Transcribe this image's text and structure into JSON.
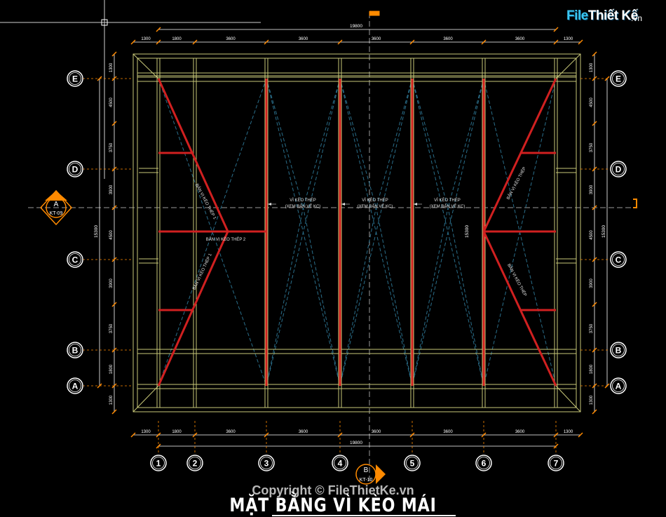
{
  "drawing": {
    "title": "MẶT BẰNG VÌ KÈO MÁI",
    "copyright": "Copyright © FileThietKe.vn",
    "logo_main": "File",
    "logo_main2": "Thiết Kế",
    "logo_suffix": ".vn"
  },
  "dimensions": {
    "total_width": "19800",
    "total_height": "15300",
    "top_segments": [
      "1300",
      "1800",
      "3600",
      "3600",
      "3600",
      "3600",
      "3600",
      "1300"
    ],
    "left_segments": [
      "1300",
      "4500",
      "3750",
      "3900",
      "4500",
      "3900",
      "3750",
      "1800",
      "1300"
    ],
    "inner_height": "15300"
  },
  "grid_axes": {
    "columns": [
      "1",
      "2",
      "3",
      "4",
      "5",
      "6",
      "7"
    ],
    "rows": [
      "E",
      "D",
      "C",
      "B",
      "A"
    ]
  },
  "section_marks": {
    "A": {
      "label": "A",
      "ref": "KT-09"
    },
    "B": {
      "label": "B",
      "ref": "KT-10"
    }
  },
  "annotations": {
    "truss_center": "VÌ KÈO THÉP",
    "truss_center_ref": "(XEM BẢN VẼ KC)",
    "truss_left_1": "BẢN VỊ KÈO THÉP 1",
    "truss_left_2": "BẢN VỊ KÈO THÉP 2",
    "truss_left_3": "BẢN VỊ KÈO THÉP 1",
    "truss_right_1": "BẢN VỊ KÈO THÉP",
    "truss_right_2": "BẢN VỊ KÈO THÉP"
  },
  "colors": {
    "background": "#000000",
    "structure": "#c8c878",
    "truss": "#d02020",
    "dimension": "#ffffff",
    "tick": "#ff8a00",
    "centerline": "#9a9a9a",
    "brace": "#2a6e8a",
    "section": "#ff8a00",
    "logo": "#39c6f2"
  }
}
